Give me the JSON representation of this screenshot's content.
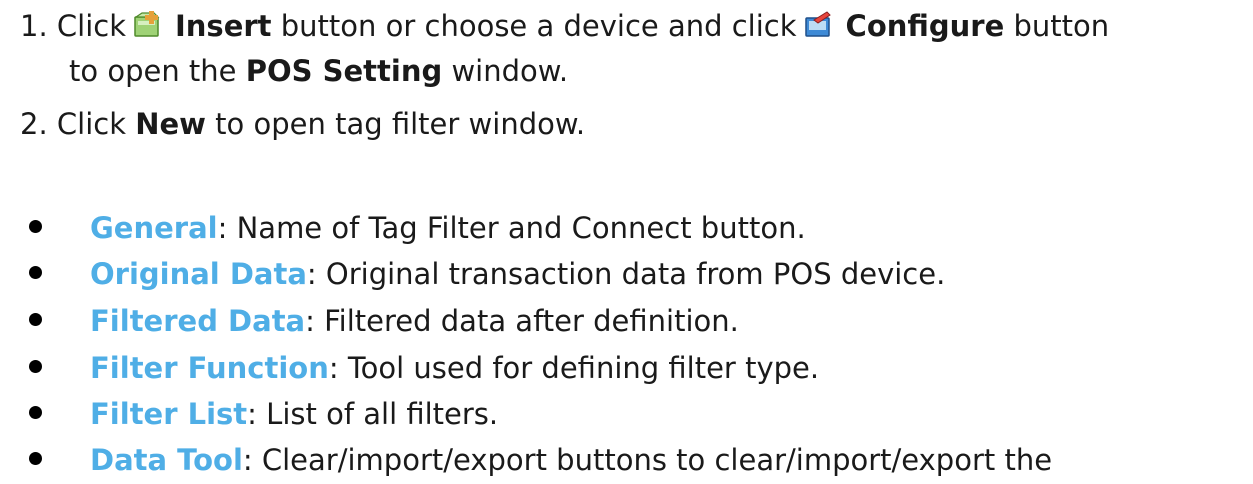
{
  "steps": [
    {
      "number": "1.",
      "click": "Click",
      "insert_icon": "insert-device-icon",
      "insert_label": "Insert",
      "middle": "button or choose a device and click",
      "configure_icon": "configure-device-icon",
      "configure_label": "Configure",
      "end": "button",
      "cont_prefix": "to open the",
      "cont_bold": "POS Setting",
      "cont_suffix": "window."
    },
    {
      "number": "2.",
      "click": "Click",
      "new_label": "New",
      "suffix": "to open tag filter window."
    }
  ],
  "bullets": [
    {
      "term": "General",
      "desc": ": Name of Tag Filter and Connect button."
    },
    {
      "term": "Original Data",
      "desc": ": Original transaction data from POS device."
    },
    {
      "term": "Filtered Data",
      "desc": ": Filtered data after definition."
    },
    {
      "term": "Filter Function",
      "desc": ": Tool used for defining filter type."
    },
    {
      "term": "Filter List",
      "desc": ": List of all filters."
    },
    {
      "term": "Data Tool",
      "desc": ": Clear/import/export buttons to clear/import/export the"
    }
  ],
  "colors": {
    "term": "#4faee6",
    "text": "#1a1a1a"
  }
}
